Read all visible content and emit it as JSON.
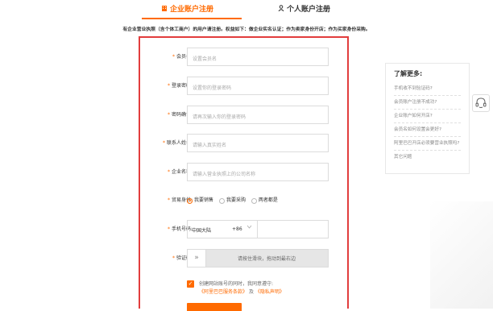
{
  "tabs": [
    {
      "label": "企业账户注册",
      "icon": "building-icon",
      "active": true
    },
    {
      "label": "个人账户注册",
      "icon": "person-icon",
      "active": false
    }
  ],
  "notice": "有企业营业执照（含个体工商户）的用户请注册。权益如下：做企业实名认证；作为卖家身份开店；作为买家身份采购。",
  "form": {
    "required_mark": "*",
    "member_name": {
      "label": "会员名:",
      "placeholder": "设置会员名"
    },
    "password": {
      "label": "登录密码:",
      "placeholder": "设置你的登录密码"
    },
    "password_confirm": {
      "label": "密码确认:",
      "placeholder": "请再次输入你的登录密码"
    },
    "contact_name": {
      "label": "联系人姓名:",
      "placeholder": "请输入真实姓名"
    },
    "company_name": {
      "label": "企业名称:",
      "placeholder": "请输入营业执照上的公司名称"
    },
    "trade_role": {
      "label": "贸易身份:",
      "options": [
        "我要销售",
        "我要采购",
        "两者都是"
      ],
      "selected": "我要销售"
    },
    "phone": {
      "label": "手机号码:",
      "region": "中国大陆",
      "code": "+86",
      "value": ""
    },
    "captcha": {
      "label": "验证码:",
      "handle": "»",
      "hint": "请按住滑块，拖动到最右边"
    },
    "agreement": {
      "checked": true,
      "text": "创建网站账号的同时，我同意遵守:",
      "link1": "《阿里巴巴服务条款》",
      "joiner": "及",
      "link2": "《隐私声明》"
    }
  },
  "help": {
    "title": "了解更多:",
    "items": [
      "手机收不到验证码?",
      "会员账户注册不成功?",
      "企业账户如何开店?",
      "会员名如何设置会更好?",
      "阿里巴巴开店必须要营业执照吗?",
      "其它问题"
    ]
  },
  "colors": {
    "accent": "#ff6a00",
    "highlight_border": "#e23d3d"
  }
}
